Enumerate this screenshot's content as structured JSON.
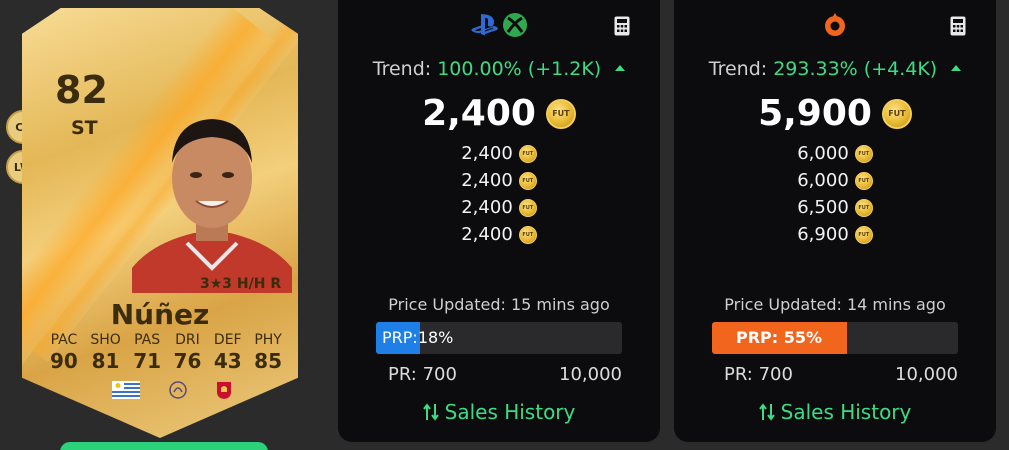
{
  "card": {
    "rating": "82",
    "position": "ST",
    "alt_positions": [
      "CF",
      "LW"
    ],
    "name": "Núñez",
    "skill_line": "3★3 H/H R",
    "stats": [
      {
        "label": "PAC",
        "value": "90"
      },
      {
        "label": "SHO",
        "value": "81"
      },
      {
        "label": "PAS",
        "value": "71"
      },
      {
        "label": "DRI",
        "value": "76"
      },
      {
        "label": "DEF",
        "value": "43"
      },
      {
        "label": "PHY",
        "value": "85"
      }
    ],
    "badges": [
      "uruguay-flag-icon",
      "premier-league-icon",
      "liverpool-crest-icon"
    ]
  },
  "console_panel": {
    "platform_icons": [
      "playstation-icon",
      "xbox-icon"
    ],
    "trend_label": "Trend:",
    "trend_value": "100.00% (+1.2K)",
    "trend_direction": "up",
    "price": "2,400",
    "coin_text": "FUT",
    "recent_prices": [
      "2,400",
      "2,400",
      "2,400",
      "2,400"
    ],
    "updated": "Price Updated: 15 mins ago",
    "prp_label": "PRP:",
    "prp_value": "18%",
    "prp_fraction": 0.18,
    "pr_min": "PR: 700",
    "pr_max": "10,000",
    "sales_history": "Sales History"
  },
  "pc_panel": {
    "platform_icons": [
      "origin-icon"
    ],
    "trend_label": "Trend:",
    "trend_value": "293.33% (+4.4K)",
    "trend_direction": "up",
    "price": "5,900",
    "coin_text": "FUT",
    "recent_prices": [
      "6,000",
      "6,000",
      "6,500",
      "6,900"
    ],
    "updated": "Price Updated: 14 mins ago",
    "prp_label": "PRP:",
    "prp_value": "55%",
    "prp_fraction": 0.55,
    "pr_min": "PR: 700",
    "pr_max": "10,000",
    "sales_history": "Sales History"
  },
  "colors": {
    "accent_green": "#3ddc84",
    "prp_console": "#1e7fe6",
    "prp_pc": "#f2651d",
    "card_gold": "#e4b756",
    "panel_bg": "#0c0c0e"
  }
}
